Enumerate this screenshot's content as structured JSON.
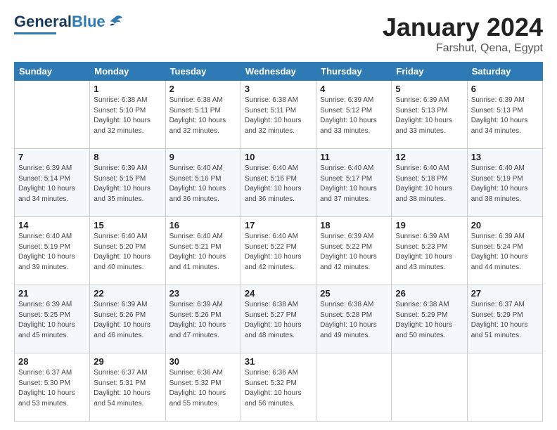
{
  "header": {
    "logo_general": "General",
    "logo_blue": "Blue",
    "month_title": "January 2024",
    "location": "Farshut, Qena, Egypt"
  },
  "days_of_week": [
    "Sunday",
    "Monday",
    "Tuesday",
    "Wednesday",
    "Thursday",
    "Friday",
    "Saturday"
  ],
  "weeks": [
    [
      {
        "day": "",
        "sunrise": "",
        "sunset": "",
        "daylight": ""
      },
      {
        "day": "1",
        "sunrise": "Sunrise: 6:38 AM",
        "sunset": "Sunset: 5:10 PM",
        "daylight": "Daylight: 10 hours and 32 minutes."
      },
      {
        "day": "2",
        "sunrise": "Sunrise: 6:38 AM",
        "sunset": "Sunset: 5:11 PM",
        "daylight": "Daylight: 10 hours and 32 minutes."
      },
      {
        "day": "3",
        "sunrise": "Sunrise: 6:38 AM",
        "sunset": "Sunset: 5:11 PM",
        "daylight": "Daylight: 10 hours and 32 minutes."
      },
      {
        "day": "4",
        "sunrise": "Sunrise: 6:39 AM",
        "sunset": "Sunset: 5:12 PM",
        "daylight": "Daylight: 10 hours and 33 minutes."
      },
      {
        "day": "5",
        "sunrise": "Sunrise: 6:39 AM",
        "sunset": "Sunset: 5:13 PM",
        "daylight": "Daylight: 10 hours and 33 minutes."
      },
      {
        "day": "6",
        "sunrise": "Sunrise: 6:39 AM",
        "sunset": "Sunset: 5:13 PM",
        "daylight": "Daylight: 10 hours and 34 minutes."
      }
    ],
    [
      {
        "day": "7",
        "sunrise": "Sunrise: 6:39 AM",
        "sunset": "Sunset: 5:14 PM",
        "daylight": "Daylight: 10 hours and 34 minutes."
      },
      {
        "day": "8",
        "sunrise": "Sunrise: 6:39 AM",
        "sunset": "Sunset: 5:15 PM",
        "daylight": "Daylight: 10 hours and 35 minutes."
      },
      {
        "day": "9",
        "sunrise": "Sunrise: 6:40 AM",
        "sunset": "Sunset: 5:16 PM",
        "daylight": "Daylight: 10 hours and 36 minutes."
      },
      {
        "day": "10",
        "sunrise": "Sunrise: 6:40 AM",
        "sunset": "Sunset: 5:16 PM",
        "daylight": "Daylight: 10 hours and 36 minutes."
      },
      {
        "day": "11",
        "sunrise": "Sunrise: 6:40 AM",
        "sunset": "Sunset: 5:17 PM",
        "daylight": "Daylight: 10 hours and 37 minutes."
      },
      {
        "day": "12",
        "sunrise": "Sunrise: 6:40 AM",
        "sunset": "Sunset: 5:18 PM",
        "daylight": "Daylight: 10 hours and 38 minutes."
      },
      {
        "day": "13",
        "sunrise": "Sunrise: 6:40 AM",
        "sunset": "Sunset: 5:19 PM",
        "daylight": "Daylight: 10 hours and 38 minutes."
      }
    ],
    [
      {
        "day": "14",
        "sunrise": "Sunrise: 6:40 AM",
        "sunset": "Sunset: 5:19 PM",
        "daylight": "Daylight: 10 hours and 39 minutes."
      },
      {
        "day": "15",
        "sunrise": "Sunrise: 6:40 AM",
        "sunset": "Sunset: 5:20 PM",
        "daylight": "Daylight: 10 hours and 40 minutes."
      },
      {
        "day": "16",
        "sunrise": "Sunrise: 6:40 AM",
        "sunset": "Sunset: 5:21 PM",
        "daylight": "Daylight: 10 hours and 41 minutes."
      },
      {
        "day": "17",
        "sunrise": "Sunrise: 6:40 AM",
        "sunset": "Sunset: 5:22 PM",
        "daylight": "Daylight: 10 hours and 42 minutes."
      },
      {
        "day": "18",
        "sunrise": "Sunrise: 6:39 AM",
        "sunset": "Sunset: 5:22 PM",
        "daylight": "Daylight: 10 hours and 42 minutes."
      },
      {
        "day": "19",
        "sunrise": "Sunrise: 6:39 AM",
        "sunset": "Sunset: 5:23 PM",
        "daylight": "Daylight: 10 hours and 43 minutes."
      },
      {
        "day": "20",
        "sunrise": "Sunrise: 6:39 AM",
        "sunset": "Sunset: 5:24 PM",
        "daylight": "Daylight: 10 hours and 44 minutes."
      }
    ],
    [
      {
        "day": "21",
        "sunrise": "Sunrise: 6:39 AM",
        "sunset": "Sunset: 5:25 PM",
        "daylight": "Daylight: 10 hours and 45 minutes."
      },
      {
        "day": "22",
        "sunrise": "Sunrise: 6:39 AM",
        "sunset": "Sunset: 5:26 PM",
        "daylight": "Daylight: 10 hours and 46 minutes."
      },
      {
        "day": "23",
        "sunrise": "Sunrise: 6:39 AM",
        "sunset": "Sunset: 5:26 PM",
        "daylight": "Daylight: 10 hours and 47 minutes."
      },
      {
        "day": "24",
        "sunrise": "Sunrise: 6:38 AM",
        "sunset": "Sunset: 5:27 PM",
        "daylight": "Daylight: 10 hours and 48 minutes."
      },
      {
        "day": "25",
        "sunrise": "Sunrise: 6:38 AM",
        "sunset": "Sunset: 5:28 PM",
        "daylight": "Daylight: 10 hours and 49 minutes."
      },
      {
        "day": "26",
        "sunrise": "Sunrise: 6:38 AM",
        "sunset": "Sunset: 5:29 PM",
        "daylight": "Daylight: 10 hours and 50 minutes."
      },
      {
        "day": "27",
        "sunrise": "Sunrise: 6:37 AM",
        "sunset": "Sunset: 5:29 PM",
        "daylight": "Daylight: 10 hours and 51 minutes."
      }
    ],
    [
      {
        "day": "28",
        "sunrise": "Sunrise: 6:37 AM",
        "sunset": "Sunset: 5:30 PM",
        "daylight": "Daylight: 10 hours and 53 minutes."
      },
      {
        "day": "29",
        "sunrise": "Sunrise: 6:37 AM",
        "sunset": "Sunset: 5:31 PM",
        "daylight": "Daylight: 10 hours and 54 minutes."
      },
      {
        "day": "30",
        "sunrise": "Sunrise: 6:36 AM",
        "sunset": "Sunset: 5:32 PM",
        "daylight": "Daylight: 10 hours and 55 minutes."
      },
      {
        "day": "31",
        "sunrise": "Sunrise: 6:36 AM",
        "sunset": "Sunset: 5:32 PM",
        "daylight": "Daylight: 10 hours and 56 minutes."
      },
      {
        "day": "",
        "sunrise": "",
        "sunset": "",
        "daylight": ""
      },
      {
        "day": "",
        "sunrise": "",
        "sunset": "",
        "daylight": ""
      },
      {
        "day": "",
        "sunrise": "",
        "sunset": "",
        "daylight": ""
      }
    ]
  ]
}
